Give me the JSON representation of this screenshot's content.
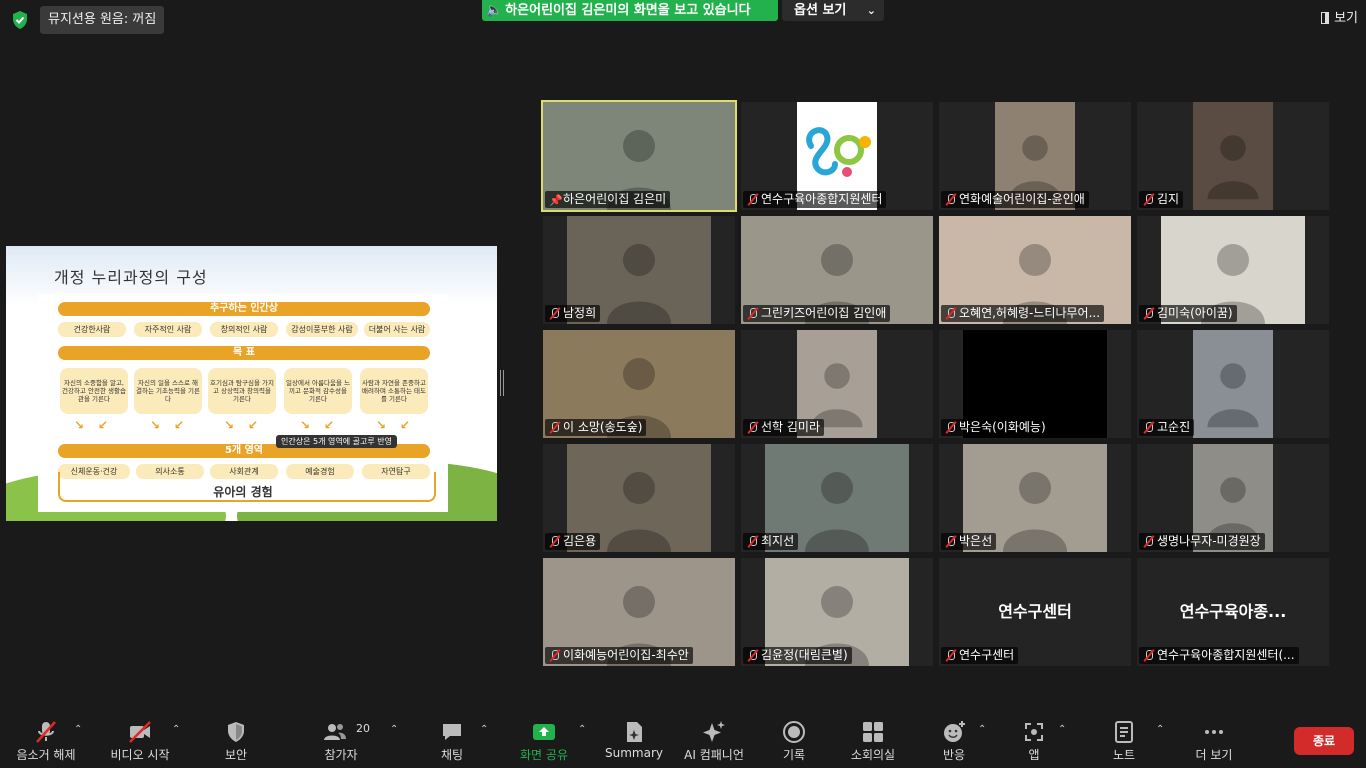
{
  "top": {
    "audio_status": "뮤지션용 원음: 꺼짐",
    "share_banner": "하은어린이집 김은미의 화면을 보고 있습니다",
    "options_label": "옵션 보기",
    "view_label": "보기"
  },
  "slide": {
    "title": "개정 누리과정의 구성",
    "section_human": "추구하는 인간상",
    "human_items": [
      "건강한사람",
      "자주적인 사람",
      "창의적인 사람",
      "감성이풍부한 사람",
      "더불어 사는 사람"
    ],
    "section_goal": "목 표",
    "goals": [
      "자신의 소중함을 알고, 건강하고 안전한 생활습관을 기른다",
      "자신의 일을 스스로 해결하는 기초능력을 기른다",
      "호기심과 탐구심을 가지고 상상력과 창의력을 기른다",
      "일상에서 아름다움을 느끼고 문화적 감수성을 기른다",
      "사람과 자연을 존중하고 배려하며 소통하는 태도를 기른다"
    ],
    "section_areas": "5개 영역",
    "tag": "인간상은 5개 영역에 골고루 반영",
    "areas": [
      "신체운동·건강",
      "의사소통",
      "사회관계",
      "예술경험",
      "자연탐구"
    ],
    "experience": "유아의 경험"
  },
  "participants": [
    {
      "name": "하은어린이집 김은미",
      "active": true,
      "pinned": true,
      "video": true,
      "bg": "#7d8678"
    },
    {
      "name": "연수구육아종합지원센터",
      "video": true,
      "bg": "#ffffff",
      "logo": true
    },
    {
      "name": "연화예술어린이집-윤인애",
      "video": true,
      "bg": "#8f8171"
    },
    {
      "name": "김지",
      "video": true,
      "bg": "#5a4c42"
    },
    {
      "name": "남정희",
      "video": true,
      "bg": "#6a6358"
    },
    {
      "name": "그린키즈어린이집 김인애",
      "video": true,
      "bg": "#9a968a"
    },
    {
      "name": "오혜연,허혜령-느티나무어...",
      "video": true,
      "bg": "#c9b7a8"
    },
    {
      "name": "김미숙(아이꿈)",
      "video": true,
      "bg": "#d8d5cc"
    },
    {
      "name": "이 소망(송도숲)",
      "video": true,
      "bg": "#8c7a5c"
    },
    {
      "name": "선학 김미라",
      "video": true,
      "bg": "#a8a096"
    },
    {
      "name": "박은숙(이화예능)",
      "video": true,
      "bg": "#000000"
    },
    {
      "name": "고순진",
      "video": true,
      "bg": "#8a8f96"
    },
    {
      "name": "김은용",
      "video": true,
      "bg": "#6e6658"
    },
    {
      "name": "최지선",
      "video": true,
      "bg": "#707a74"
    },
    {
      "name": "박은선",
      "video": true,
      "bg": "#a39c90"
    },
    {
      "name": "생명나무자-미경원장",
      "video": true,
      "bg": "#8e8d88"
    },
    {
      "name": "이화예능어린이집-최수안",
      "video": true,
      "bg": "#9d948a"
    },
    {
      "name": "김윤정(대림큰별)",
      "video": true,
      "bg": "#b3aea4"
    },
    {
      "name": "연수구센터",
      "video": false,
      "center": "연수구센터"
    },
    {
      "name": "연수구육아종합지원센터(...",
      "video": false,
      "center": "연수구육아종..."
    }
  ],
  "toolbar": {
    "unmute": "음소거 해제",
    "start_video": "비디오 시작",
    "security": "보안",
    "participants": "참가자",
    "participants_count": "20",
    "chat": "채팅",
    "share": "화면 공유",
    "summary": "Summary",
    "ai": "AI 컴패니언",
    "record": "기록",
    "breakout": "소회의실",
    "reactions": "반응",
    "apps": "앱",
    "notes": "노트",
    "more": "더 보기",
    "end": "종료"
  },
  "colors": {
    "share_green": "#23b14d",
    "active_speaker": "#dedc6e",
    "end_red": "#d32a2a",
    "slide_orange": "#e9a327"
  }
}
